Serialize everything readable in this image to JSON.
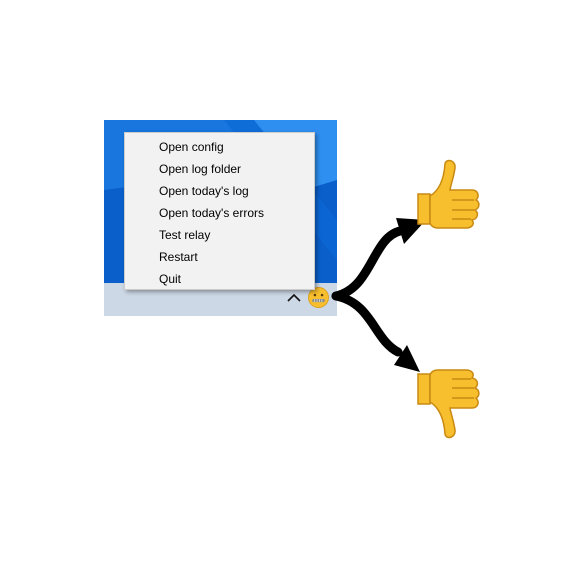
{
  "context_menu": {
    "items": [
      {
        "label": "Open config",
        "name": "menu-item-open-config"
      },
      {
        "label": "Open log folder",
        "name": "menu-item-open-log-folder"
      },
      {
        "label": "Open today's log",
        "name": "menu-item-open-todays-log"
      },
      {
        "label": "Open today's errors",
        "name": "menu-item-open-todays-errors"
      },
      {
        "label": "Test relay",
        "name": "menu-item-test-relay"
      },
      {
        "label": "Restart",
        "name": "menu-item-restart"
      },
      {
        "label": "Quit",
        "name": "menu-item-quit"
      }
    ]
  },
  "taskbar": {
    "overflow_icon": "chevron-up-icon",
    "tray_icon": "zipper-mouth-face-icon"
  },
  "annotation": {
    "up_icon": "thumbs-up-icon",
    "down_icon": "thumbs-down-icon"
  },
  "colors": {
    "desktop_blue": "#0b63cf",
    "taskbar": "#cdd8e6",
    "menu_background": "#f2f2f2",
    "emoji_yellow": "#f7be2e"
  }
}
